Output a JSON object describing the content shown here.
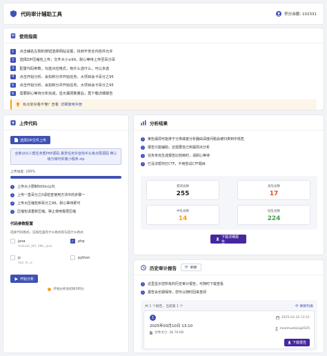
{
  "header": {
    "title": "代码审计辅助工具",
    "points_label": "积分余额: 102331"
  },
  "guide": {
    "title": "使用指南",
    "steps": [
      "点击辅名左侧的按钮选择网站设置，找到不安全内容并允许",
      "选择ZIP压缩包上传，文件大小≤99，耐心等待上传至百分百",
      "配置代码参数，勾选对应格式，有什么选什么，可以多选",
      "点击开始分析，会扣积分并开始任务，大项目会卡百分之95",
      "点击开始分析，会扣积分并开始任务，大项目会卡百分之95",
      "需要耐心等待分析完成，显示漏洞数量后，再下载详细报告"
    ],
    "notice_text": "有点复杂看不懂？查看",
    "notice_link": "详细使用手册"
  },
  "upload": {
    "title": "上传代码",
    "select_button": "选择ZIP文件上传",
    "file_name": "全新UI众人帮任务帮PHP源码 悬赏任务抖音快手头条点赞源码 带三级分销可封装小程序.zip",
    "progress_label": "上传进度: 100%",
    "progress": 1.0,
    "rules": [
      "上传大小限制500m以内",
      "上传一直百分之0请检查使用方法中的步骤一",
      "上传大压缩包到百分之99，耐心等待即可",
      "压缩包请重新压缩，禁止使用极限压缩"
    ]
  },
  "config": {
    "title": "代码参数配置",
    "subtitle": "选择代码格式，压缩包里有什么格式就勾选什么格式",
    "options": [
      {
        "name": "java",
        "desc": "Android, JSP, XML, java",
        "checked": false
      },
      {
        "name": "php",
        "desc": "",
        "checked": true
      },
      {
        "name": "js",
        "desc": "Vue, ts, js",
        "checked": false
      },
      {
        "name": "python",
        "desc": "",
        "checked": false
      }
    ],
    "start_button": "开始分析",
    "cost_note": "开始分析会扣除5积分"
  },
  "results": {
    "title": "分析结果",
    "notes": [
      "某些漏洞可能排于分类或者分析器由深度问题会被归类到中低危",
      "报告只能辅助，还需要自己到漏洞点分析",
      "任务未完生成报告比较耗时，请耐心等待",
      "已没法帮你打CTF，不用尝试CTF题目"
    ],
    "stats": [
      {
        "label": "漏洞总数",
        "value": "255",
        "color": "#222222"
      },
      {
        "label": "高危总数",
        "value": "17",
        "color": "#e64a19"
      },
      {
        "label": "中危总数",
        "value": "14",
        "color": "#f0a020"
      },
      {
        "label": "低危总数",
        "value": "224",
        "color": "#43a047"
      }
    ],
    "download_button": "下载详细报告"
  },
  "history": {
    "title": "历史审计报告",
    "refresh_button": "刷新",
    "notes": [
      "这里显示您所有的历史审计报告，可随时下载查看",
      "报告会长期保存，您可以随时回来查阅"
    ],
    "count_text": "共 1 个报告，当前第 1 个",
    "list_button": "刷新列表",
    "item": {
      "index": "1",
      "date": "2025-03-10 13:51",
      "title": "2025年03月10日 13:10",
      "size": "文件大小: 36.76 KB",
      "user": "mianhuataing2025",
      "download": "下载报告"
    }
  }
}
